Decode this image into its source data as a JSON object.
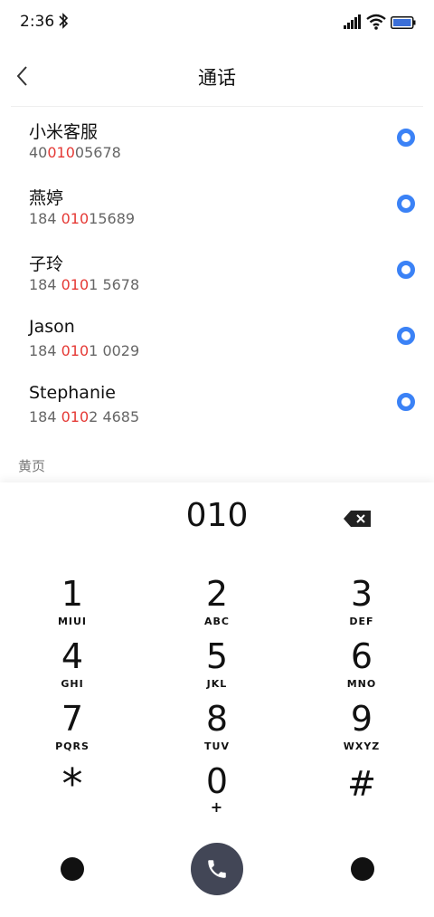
{
  "status_bar": {
    "time": "2:36"
  },
  "header": {
    "title": "通话"
  },
  "results": [
    {
      "name": "小米客服",
      "number_parts": [
        "40",
        "010",
        "05678"
      ]
    },
    {
      "name": "燕婷",
      "number_parts": [
        "184 ",
        "010",
        "15689"
      ]
    },
    {
      "name": "子玲",
      "number_parts": [
        "184 ",
        "010",
        "1 5678"
      ]
    },
    {
      "name": "Jason",
      "number_parts": [
        "184 ",
        "010",
        "1 0029"
      ]
    },
    {
      "name": "Stephanie",
      "number_parts": [
        "184 ",
        "010",
        "2 4685"
      ]
    }
  ],
  "section_label": "黄页",
  "dialer": {
    "input": "010",
    "keys": [
      {
        "digit": "1",
        "letters": "MIUI"
      },
      {
        "digit": "2",
        "letters": "ABC"
      },
      {
        "digit": "3",
        "letters": "DEF"
      },
      {
        "digit": "4",
        "letters": "GHI"
      },
      {
        "digit": "5",
        "letters": "JKL"
      },
      {
        "digit": "6",
        "letters": "MNO"
      },
      {
        "digit": "7",
        "letters": "PQRS"
      },
      {
        "digit": "8",
        "letters": "TUV"
      },
      {
        "digit": "9",
        "letters": "WXYZ"
      },
      {
        "digit": "*",
        "letters": ""
      },
      {
        "digit": "0",
        "letters": "+"
      },
      {
        "digit": "#",
        "letters": ""
      }
    ]
  },
  "colors": {
    "highlight": "#e53935",
    "radio": "#3b82f6",
    "call_button": "#424656"
  }
}
